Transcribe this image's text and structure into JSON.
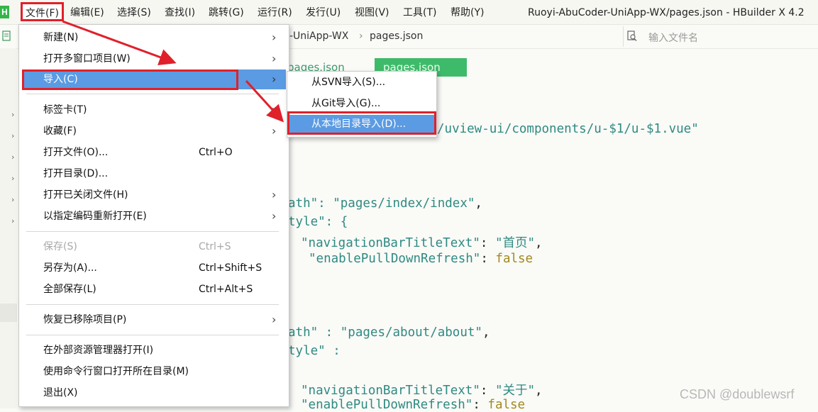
{
  "menubar": {
    "logo": "H",
    "items": [
      "文件(F)",
      "编辑(E)",
      "选择(S)",
      "查找(I)",
      "跳转(G)",
      "运行(R)",
      "发行(U)",
      "视图(V)",
      "工具(T)",
      "帮助(Y)"
    ]
  },
  "window": {
    "title": "Ruoyi-AbuCoder-UniApp-WX/pages.json - HBuilder X 4.2"
  },
  "breadcrumb": {
    "project": "-UniApp-WX",
    "separator": "›",
    "file": "pages.json"
  },
  "search": {
    "placeholder": "输入文件名",
    "value": ""
  },
  "editor_tabs": [
    "pages.json",
    "pages.json"
  ],
  "code_lines": {
    "l1": "/uview-ui/components/u-$1/u-$1.vue\"",
    "l2a": "ath\": ",
    "l2b": "\"pages/index/index\"",
    "l2c": ",",
    "l3a": "tyle\": {",
    "l4a": "\"navigationBarTitleText\"",
    "l4b": ": ",
    "l4c": "\"首页\"",
    "l4d": ",",
    "l5a": "\"enablePullDownRefresh\"",
    "l5b": ": ",
    "l5c": "false",
    "l6a": "ath\" : ",
    "l6b": "\"pages/about/about\"",
    "l6c": ",",
    "l7a": "tyle\" :",
    "l8a": "\"navigationBarTitleText\"",
    "l8b": ": ",
    "l8c": "\"关于\"",
    "l8d": ",",
    "l9a": "\"enablePullDownRefresh\"",
    "l9b": ": ",
    "l9c": "false"
  },
  "file_menu": {
    "items": [
      {
        "label": "新建(N)",
        "shortcut": "",
        "submenu": true,
        "disabled": false
      },
      {
        "label": "打开多窗口项目(W)",
        "shortcut": "",
        "submenu": true,
        "disabled": false
      },
      {
        "label": "导入(C)",
        "shortcut": "",
        "submenu": true,
        "disabled": false,
        "highlighted": true
      },
      {
        "label": "标签卡(T)",
        "shortcut": "",
        "submenu": true,
        "disabled": false
      },
      {
        "label": "收藏(F)",
        "shortcut": "",
        "submenu": true,
        "disabled": false
      },
      {
        "label": "打开文件(O)...",
        "shortcut": "Ctrl+O",
        "submenu": false,
        "disabled": false
      },
      {
        "label": "打开目录(D)...",
        "shortcut": "",
        "submenu": false,
        "disabled": false
      },
      {
        "label": "打开已关闭文件(H)",
        "shortcut": "",
        "submenu": true,
        "disabled": false
      },
      {
        "label": "以指定编码重新打开(E)",
        "shortcut": "",
        "submenu": true,
        "disabled": false
      },
      {
        "label": "保存(S)",
        "shortcut": "Ctrl+S",
        "submenu": false,
        "disabled": true
      },
      {
        "label": "另存为(A)...",
        "shortcut": "Ctrl+Shift+S",
        "submenu": false,
        "disabled": false
      },
      {
        "label": "全部保存(L)",
        "shortcut": "Ctrl+Alt+S",
        "submenu": false,
        "disabled": false
      },
      {
        "label": "恢复已移除项目(P)",
        "shortcut": "",
        "submenu": true,
        "disabled": false
      },
      {
        "label": "在外部资源管理器打开(I)",
        "shortcut": "",
        "submenu": false,
        "disabled": false
      },
      {
        "label": "使用命令行窗口打开所在目录(M)",
        "shortcut": "",
        "submenu": false,
        "disabled": false
      },
      {
        "label": "退出(X)",
        "shortcut": "",
        "submenu": false,
        "disabled": false
      }
    ]
  },
  "import_submenu": {
    "items": [
      {
        "label": "从SVN导入(S)..."
      },
      {
        "label": "从Git导入(G)..."
      },
      {
        "label": "从本地目录导入(D)...",
        "highlighted": true
      }
    ]
  },
  "watermark": "CSDN @doublewsrf",
  "colors": {
    "highlight": "#5b9be3",
    "annotation": "#e0202a",
    "string": "#2f8a82",
    "keyword": "#a08a1c",
    "logo": "#35b44a"
  }
}
